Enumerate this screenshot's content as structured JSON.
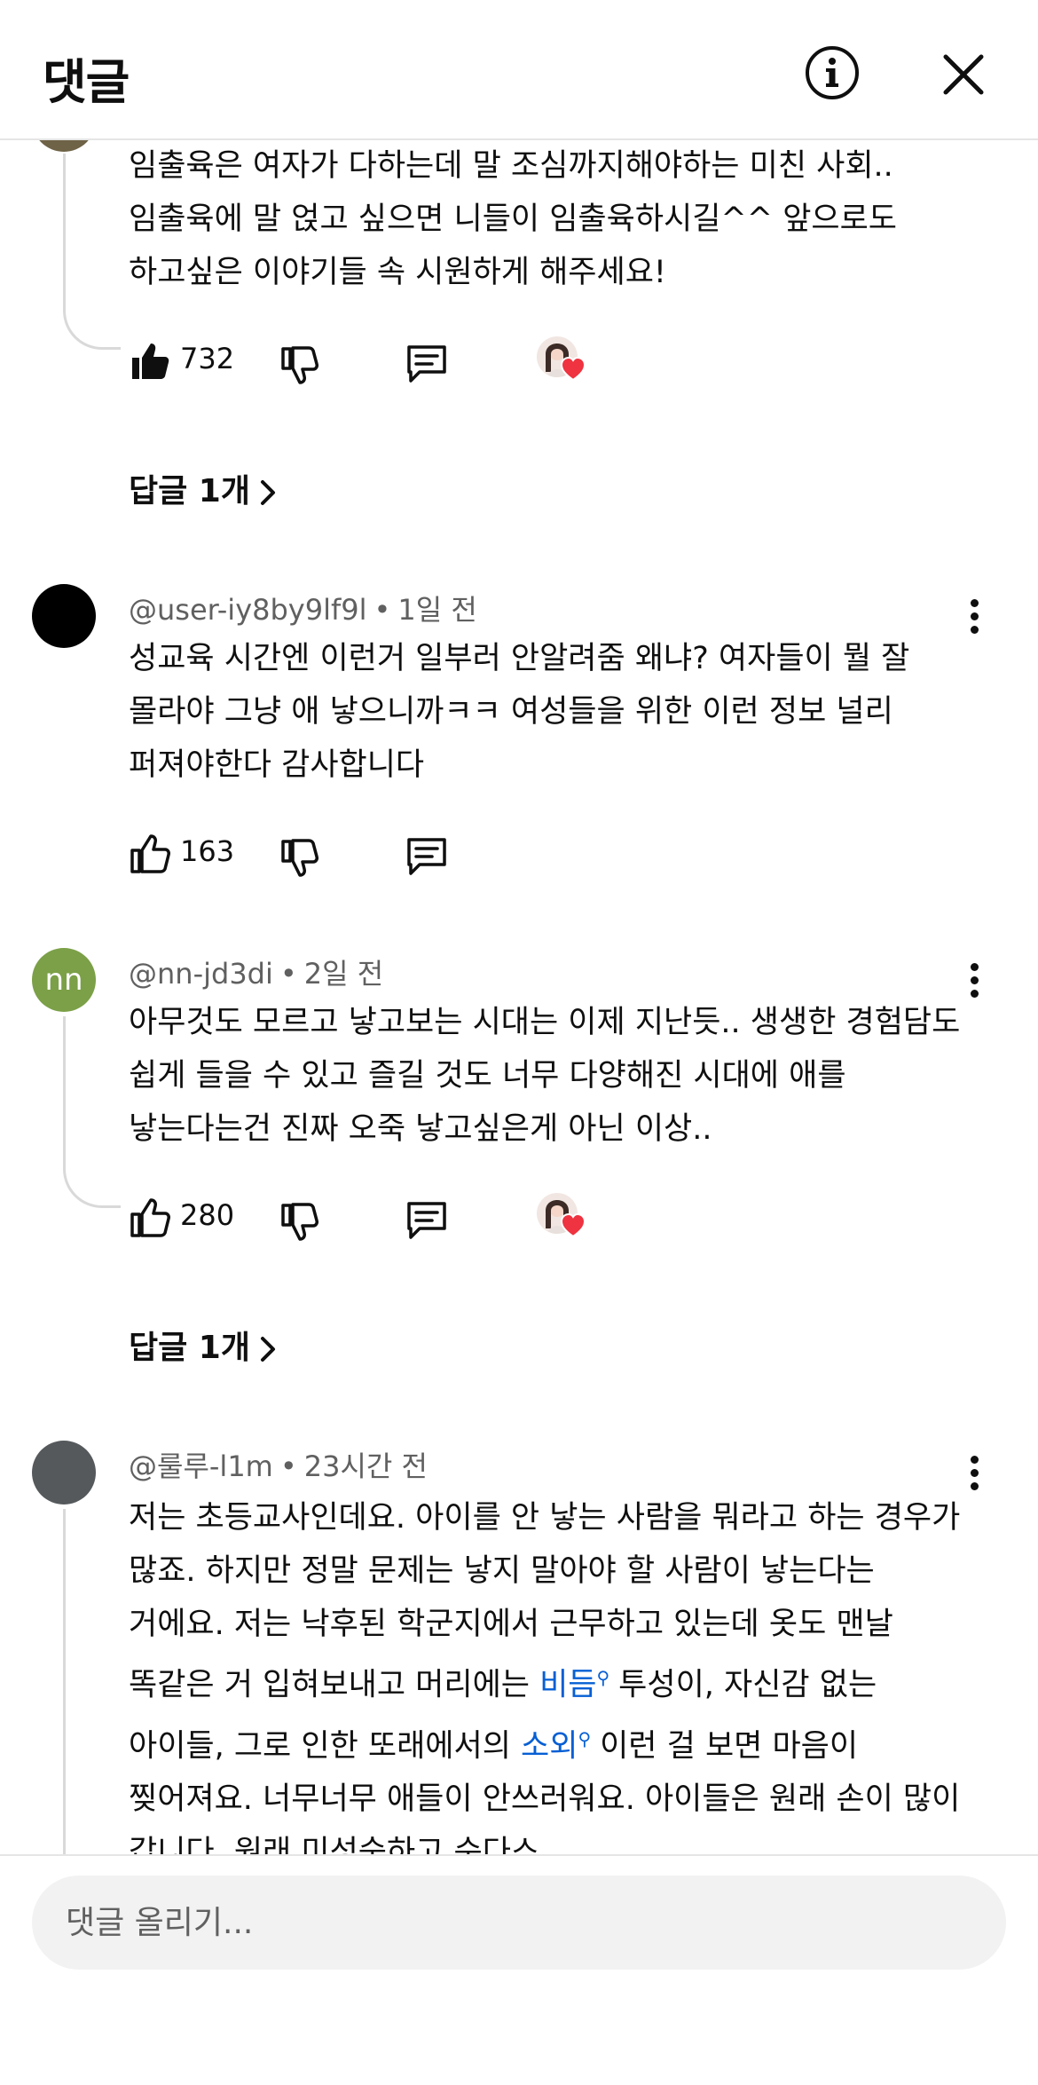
{
  "header": {
    "title": "댓글"
  },
  "comments": [
    {
      "text": "임출육은 여자가 다하는데 말 조심까지해야하는 미친 사회.. 임출육에 말 얹고 싶으면 니들이 임출육하시길^^ 앞으로도 하고싶은 이야기들 속 시원하게 해주세요!",
      "likes": "732",
      "replies_label": "답글 1개"
    },
    {
      "author": "@user-iy8by9lf9l",
      "time": "1일 전",
      "avatar_color": "#000000",
      "text": "성교육 시간엔 이런거 일부러 안알려줌 왜냐? 여자들이 뭘 잘 몰라야 그냥 애 낳으니까ㅋㅋ 여성들을 위한 이런 정보 널리 퍼져야한다 감사합니다",
      "likes": "163"
    },
    {
      "author": "@nn-jd3di",
      "time": "2일 전",
      "avatar_letter": "nn",
      "avatar_color": "#7ba047",
      "text": "아무것도 모르고 낳고보는 시대는 이제 지난듯.. 생생한 경험담도 쉽게 들을 수 있고 즐길 것도 너무 다양해진 시대에 애를 낳는다는건 진짜 오죽 낳고싶은게 아닌 이상..",
      "likes": "280",
      "replies_label": "답글 1개"
    },
    {
      "author": "@룰루-l1m",
      "time": "23시간 전",
      "avatar_color": "#55595c",
      "text_part1": "저는 초등교사인데요. 아이를 안 낳는 사람을 뭐라고 하는 경우가 많죠. 하지만 정말 문제는 낳지 말아야 할 사람이 낳는다는 거에요. 저는 낙후된 학군지에서 근무하고 있는데 옷도 맨날 똑같은 거 입혀보내고 머리에는 ",
      "link1": "비듬",
      "text_part2": "투성이, 자신감 없는 아이들, 그로 인한 또래에서의 ",
      "link2": "소외",
      "text_part3": "이런 걸 보면 마음이 찢어져요. 너무너무 애들이 안쓰러워요. 아이들은 원래 손이 많이 갑니다. 원래 미성숙하고 순다스"
    }
  ],
  "footer": {
    "input_placeholder": "댓글 올리기..."
  },
  "colors": {
    "link": "#065fd4",
    "heart": "#ef3340",
    "divider": "#e5e5e5"
  },
  "icons": [
    "info-icon",
    "close-icon",
    "thumbs-up-icon",
    "thumbs-down-icon",
    "reply-icon",
    "more-vert-icon",
    "chevron-right-icon",
    "heart-icon",
    "search-icon"
  ]
}
